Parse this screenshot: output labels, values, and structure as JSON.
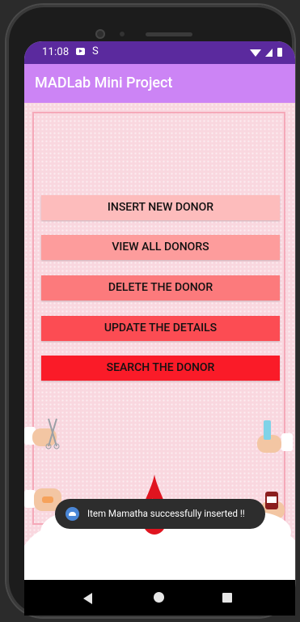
{
  "status_bar": {
    "time": "11:08",
    "icons": [
      "media-icon",
      "sim-s-icon",
      "wifi-icon",
      "signal-icon",
      "battery-icon"
    ]
  },
  "app_bar": {
    "title": "MADLab Mini Project",
    "color": "#cc84f5"
  },
  "menu": {
    "buttons": [
      {
        "label": "INSERT NEW DONOR",
        "color": "#fdbcbc"
      },
      {
        "label": "VIEW ALL DONORS",
        "color": "#fd9c9c"
      },
      {
        "label": "DELETE THE DONOR",
        "color": "#fc7a7c"
      },
      {
        "label": "UPDATE THE DETAILS",
        "color": "#fc4c53"
      },
      {
        "label": "SEARCH THE DONOR",
        "color": "#fa1b28"
      }
    ]
  },
  "toast": {
    "message": "Item Mamatha successfully inserted !!"
  },
  "nav_bar": {
    "icons": [
      "back-icon",
      "home-icon",
      "recents-icon"
    ]
  },
  "colors": {
    "status_bar": "#5b2a9e",
    "background": "#f9d7df",
    "frame": "#f5a9b9"
  }
}
